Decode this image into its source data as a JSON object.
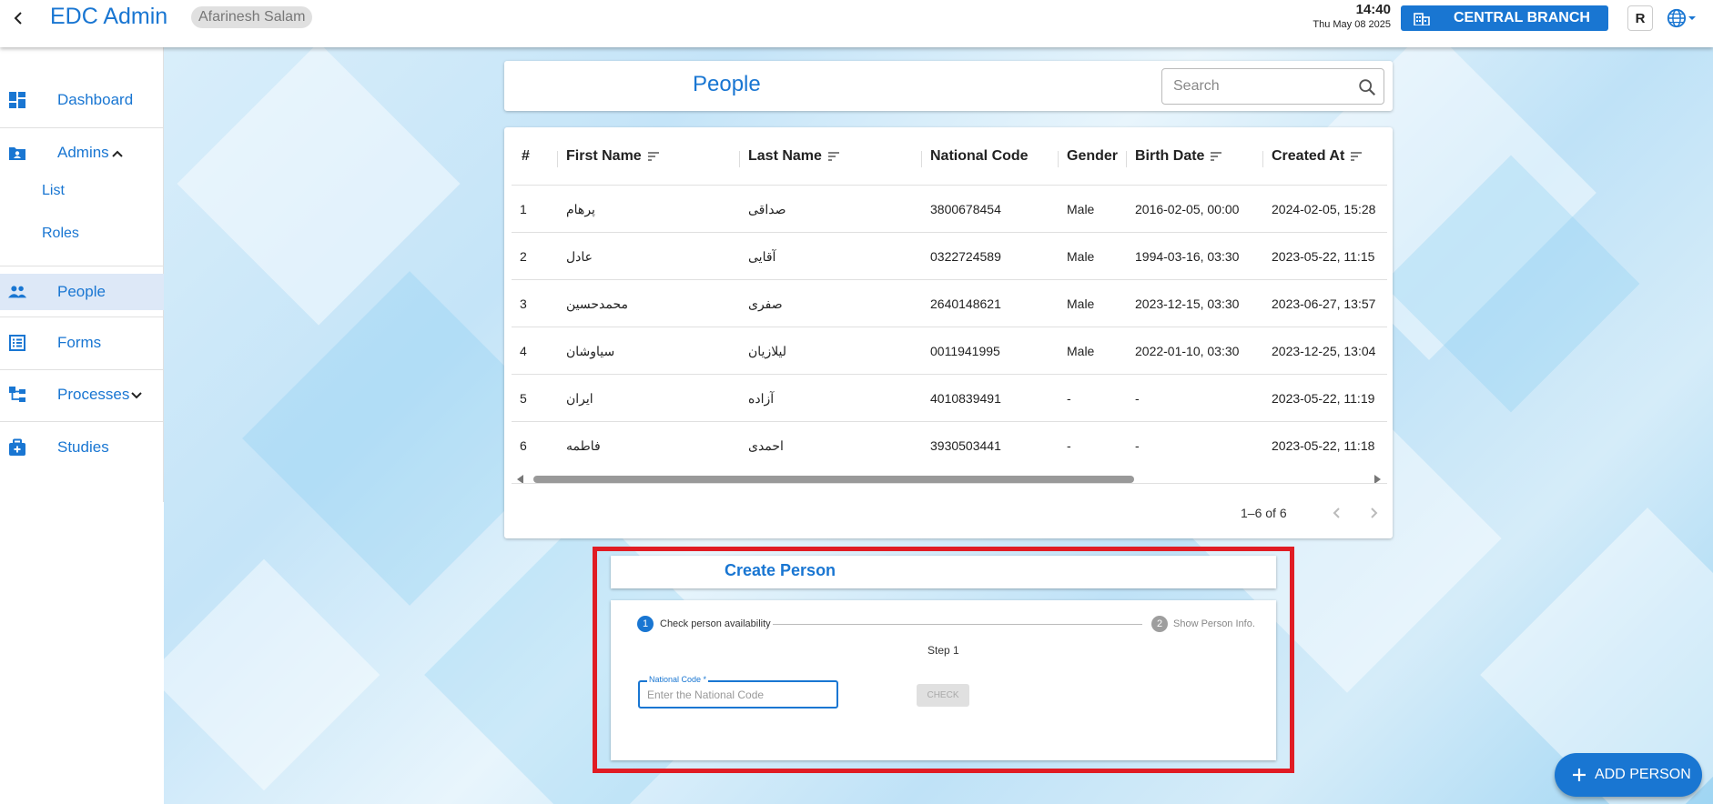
{
  "app": {
    "title": "EDC Admin",
    "user": "Afarinesh Salam"
  },
  "header": {
    "time": "14:40",
    "date": "Thu May 08 2025",
    "branch": "CENTRAL BRANCH",
    "role_badge": "R"
  },
  "sidebar": {
    "items": [
      {
        "label": "Dashboard",
        "icon": "dashboard-icon"
      },
      {
        "label": "Admins",
        "icon": "admin-folder-icon",
        "expanded": true
      },
      {
        "label": "List"
      },
      {
        "label": "Roles"
      },
      {
        "label": "People",
        "icon": "people-icon",
        "active": true
      },
      {
        "label": "Forms",
        "icon": "form-icon"
      },
      {
        "label": "Processes",
        "icon": "process-icon",
        "expanded": false
      },
      {
        "label": "Studies",
        "icon": "studies-icon"
      }
    ]
  },
  "people": {
    "title": "People",
    "search_placeholder": "Search"
  },
  "table": {
    "columns": [
      "#",
      "First Name",
      "Last Name",
      "National Code",
      "Gender",
      "Birth Date",
      "Created At"
    ],
    "rows": [
      [
        "1",
        "پرهام",
        "صداقی",
        "3800678454",
        "Male",
        "2016-02-05, 00:00",
        "2024-02-05, 15:28"
      ],
      [
        "2",
        "عادل",
        "آقایی",
        "0322724589",
        "Male",
        "1994-03-16, 03:30",
        "2023-05-22, 11:15"
      ],
      [
        "3",
        "محمدحسین",
        "صفری",
        "2640148621",
        "Male",
        "2023-12-15, 03:30",
        "2023-06-27, 13:57"
      ],
      [
        "4",
        "سیاوشان",
        "لیلازیان",
        "0011941995",
        "Male",
        "2022-01-10, 03:30",
        "2023-12-25, 13:04"
      ],
      [
        "5",
        "ایران",
        "آزاده",
        "4010839491",
        "-",
        "-",
        "2023-05-22, 11:19"
      ],
      [
        "6",
        "فاطمه",
        "احمدی",
        "3930503441",
        "-",
        "-",
        "2023-05-22, 11:18"
      ]
    ],
    "pagination": "1–6 of 6"
  },
  "create_person": {
    "title": "Create Person",
    "step1_number": "1",
    "step1_label": "Check person availability",
    "step2_number": "2",
    "step2_label": "Show Person Info.",
    "step_caption": "Step 1",
    "national_code_label": "National Code *",
    "national_code_placeholder": "Enter the National Code",
    "national_code_value": "",
    "check_label": "CHECK"
  },
  "fab": {
    "label": "ADD PERSON"
  },
  "colors": {
    "primary": "#1976d2",
    "highlight": "#e01c24",
    "active_bg": "#dde8f7"
  }
}
